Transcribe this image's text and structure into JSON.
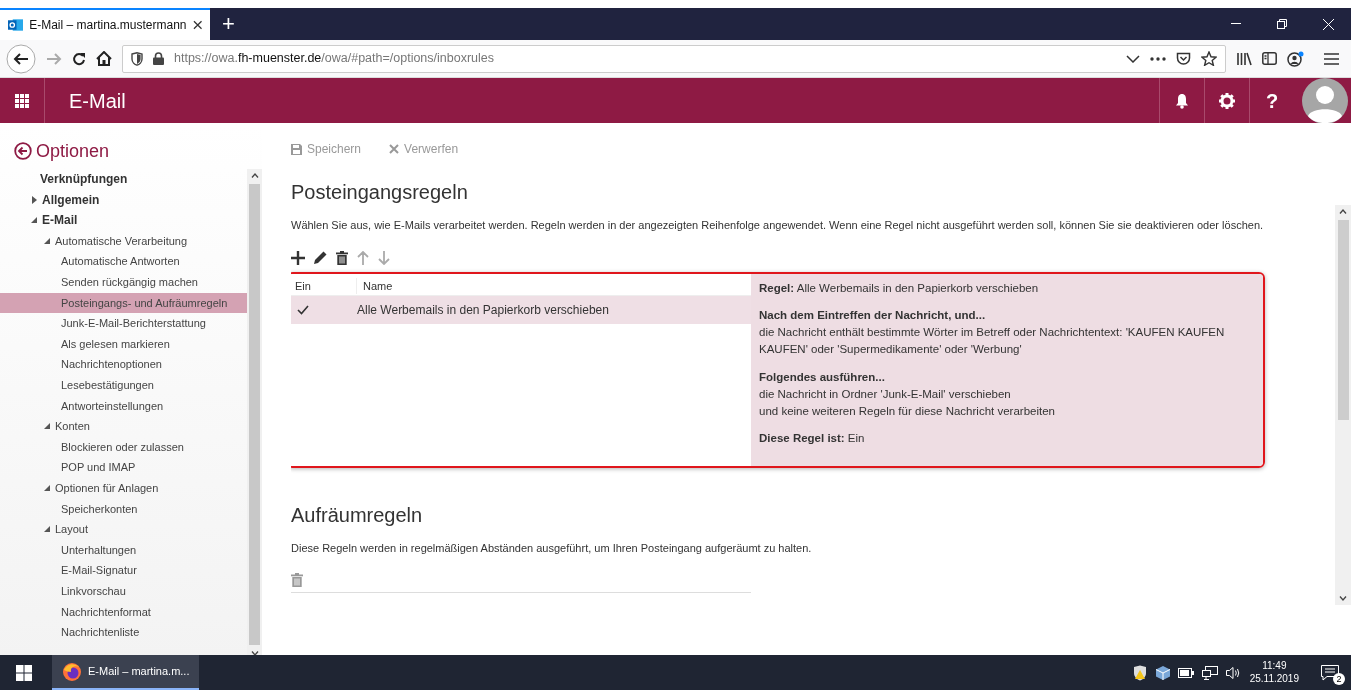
{
  "browser": {
    "tab": {
      "title": "E-Mail – martina.mustermann",
      "selected": true
    },
    "new_tab": "+",
    "url": {
      "host_pre": "https://owa.",
      "host": "fh-muenster.de",
      "path": "/owa/#path=/options/inboxrules"
    }
  },
  "app_header": {
    "title": "E-Mail",
    "help": "?"
  },
  "sidebar": {
    "title": "Optionen",
    "items": [
      {
        "label": "Verknüpfungen",
        "selected": false
      },
      {
        "label": "Allgemein",
        "selected": false,
        "expanded": false
      },
      {
        "label": "E-Mail",
        "selected": false,
        "expanded": true,
        "children": [
          {
            "label": "Automatische Verarbeitung",
            "selected": false,
            "expanded": true,
            "children": [
              {
                "label": "Automatische Antworten",
                "selected": false
              },
              {
                "label": "Senden rückgängig machen",
                "selected": false
              },
              {
                "label": "Posteingangs- und Aufräumregeln",
                "selected": true
              },
              {
                "label": "Junk-E-Mail-Berichterstattung",
                "selected": false
              },
              {
                "label": "Als gelesen markieren",
                "selected": false
              },
              {
                "label": "Nachrichtenoptionen",
                "selected": false
              },
              {
                "label": "Lesebestätigungen",
                "selected": false
              },
              {
                "label": "Antworteinstellungen",
                "selected": false
              }
            ]
          },
          {
            "label": "Konten",
            "selected": false,
            "expanded": true,
            "children": [
              {
                "label": "Blockieren oder zulassen",
                "selected": false
              },
              {
                "label": "POP und IMAP",
                "selected": false
              }
            ]
          },
          {
            "label": "Optionen für Anlagen",
            "selected": false,
            "expanded": true,
            "children": [
              {
                "label": "Speicherkonten",
                "selected": false
              }
            ]
          },
          {
            "label": "Layout",
            "selected": false,
            "expanded": true,
            "children": [
              {
                "label": "Unterhaltungen",
                "selected": false
              },
              {
                "label": "E-Mail-Signatur",
                "selected": false
              },
              {
                "label": "Linkvorschau",
                "selected": false
              },
              {
                "label": "Nachrichtenformat",
                "selected": false
              },
              {
                "label": "Nachrichtenliste",
                "selected": false
              }
            ]
          }
        ]
      }
    ]
  },
  "toolbar": {
    "save": "Speichern",
    "discard": "Verwerfen",
    "disabled": true
  },
  "inbox_rules": {
    "title": "Posteingangsregeln",
    "description": "Wählen Sie aus, wie E-Mails verarbeitet werden. Regeln werden in der angezeigten Reihenfolge angewendet. Wenn eine Regel nicht ausgeführt werden soll, können Sie sie deaktivieren oder löschen.",
    "columns": [
      "Ein",
      "Name"
    ],
    "rows": [
      {
        "enabled": true,
        "name": "Alle Werbemails in den Papierkorb verschieben",
        "selected": true
      }
    ],
    "details": [
      {
        "lines": [
          "**Regel:** Alle Werbemails in den Papierkorb verschieben"
        ]
      },
      {
        "heading": "Nach dem Eintreffen der Nachricht, und...",
        "lines": [
          "die Nachricht enthält bestimmte Wörter im Betreff oder Nachrichtentext: 'KAUFEN KAUFEN KAUFEN' oder 'Supermedikamente' oder 'Werbung'"
        ]
      },
      {
        "heading": "Folgendes ausführen...",
        "lines": [
          "die Nachricht in Ordner 'Junk-E-Mail' verschieben",
          "und keine weiteren Regeln für diese Nachricht verarbeiten"
        ]
      },
      {
        "lines": [
          "**Diese Regel ist:** Ein"
        ]
      }
    ]
  },
  "sweep_rules": {
    "title": "Aufräumregeln",
    "description": "Diese Regeln werden in regelmäßigen Abständen ausgeführt, um Ihren Posteingang aufgeräumt zu halten."
  },
  "taskbar": {
    "task": "E-Mail – martina.m...",
    "time": "11:49",
    "date": "25.11.2019",
    "notifications": "2"
  }
}
